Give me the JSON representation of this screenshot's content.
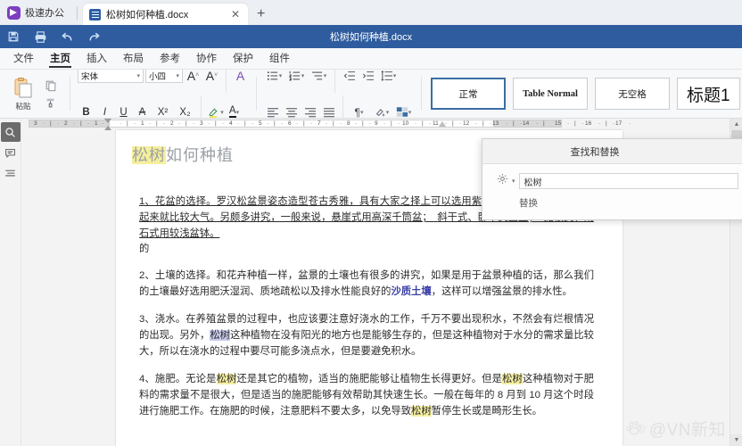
{
  "tabstrip": {
    "brand": "极速办公",
    "brand_icon": "rocket-logo-icon",
    "doc_tab": {
      "title": "松树如何种植.docx",
      "icon": "document-icon",
      "close": "✕"
    },
    "new_tab": "+"
  },
  "quickbar": {
    "title": "松树如何种植.docx",
    "buttons": [
      {
        "name": "save-button",
        "icon": "save-icon"
      },
      {
        "name": "print-button",
        "icon": "printer-icon"
      },
      {
        "name": "undo-button",
        "icon": "undo-arrow-icon"
      },
      {
        "name": "redo-button",
        "icon": "redo-arrow-icon"
      }
    ]
  },
  "menubar": {
    "items": [
      {
        "label": "文件",
        "active": false
      },
      {
        "label": "主页",
        "active": true
      },
      {
        "label": "插入",
        "active": false
      },
      {
        "label": "布局",
        "active": false
      },
      {
        "label": "参考",
        "active": false
      },
      {
        "label": "协作",
        "active": false
      },
      {
        "label": "保护",
        "active": false
      },
      {
        "label": "组件",
        "active": false
      }
    ]
  },
  "ribbon": {
    "paste_label": "粘贴",
    "font_name": "宋体",
    "font_size": "小四",
    "grow_font": "A",
    "shrink_font": "A",
    "clear_format": "A",
    "bold": "B",
    "italic": "I",
    "underline": "U",
    "strike": "A",
    "superscript": "X²",
    "subscript": "X₂",
    "text_highlight": "highlight-pen-icon",
    "font_color": "A",
    "styles": [
      {
        "label": "正常",
        "selected": true
      },
      {
        "label": "Table Normal",
        "selected": false
      },
      {
        "label": "无空格",
        "selected": false
      },
      {
        "label": "标题1",
        "selected": false
      }
    ]
  },
  "leftbar": {
    "items": [
      {
        "name": "search-icon",
        "active": true
      },
      {
        "name": "comment-icon",
        "active": false
      },
      {
        "name": "outline-icon",
        "active": false
      }
    ]
  },
  "ruler": {
    "left_labels": [
      "3",
      "2",
      "1"
    ],
    "right_labels": [
      "1",
      "2",
      "3",
      "4",
      "5",
      "6",
      "7",
      "8",
      "9",
      "10",
      "11",
      "12",
      "13",
      "14",
      "15",
      "16",
      "17"
    ]
  },
  "document": {
    "title_highlight": "松树",
    "title_rest": "如何种植",
    "paragraphs": [
      {
        "id": "p1",
        "underline": true,
        "text": "1、花盆的选择。罗汉松盆景姿态造型苍古秀雅，具有大家之择上可以选用紫砂陶盆或釉陶盆，这样看起来就比较大气。另颇多讲究，一般来说，悬崖式用高深千筒盆；　斜干式、卧干式圆盆；　提根式、附石式用较浅盆钵。"
      },
      {
        "id": "p1b",
        "underline": false,
        "text": "的"
      },
      {
        "id": "p2",
        "underline": false,
        "pre": "2、土壤的选择。和花卉种植一样，盆景的土壤也有很多的讲究，如果是用于盆景种植的话，那么我们的土壤最好选用肥沃湿润、质地疏松以及排水性能良好的",
        "emphasis": "沙质土壤",
        "post": "，这样可以增强盆景的排水性。"
      },
      {
        "id": "p3",
        "underline": false,
        "pre": "3、浇水。在养殖盆景的过程中，也应该要注意好浇水的工作，千万不要出现积水，不然会有烂根情况的出现。另外，",
        "selected": "松树",
        "post": "这种植物在没有阳光的地方也是能够生存的，但是这种植物对于水分的需求量比较大，所以在浇水的过程中要尽可能多浇点水，但是要避免积水。"
      },
      {
        "id": "p4",
        "underline": false,
        "segments": [
          {
            "t": "4、施肥。无论是",
            "m": ""
          },
          {
            "t": "松树",
            "m": "y"
          },
          {
            "t": "还是其它的植物，适当的施肥能够让植物生长得更好。但是",
            "m": ""
          },
          {
            "t": "松树",
            "m": "y"
          },
          {
            "t": "这种植物对于肥料的需求量不是很大，但是适当的施肥能够有效帮助其快速生长。一般在每年的 8 月到 10 月这个时段进行施肥工作。在施肥的时候，注意肥料不要太多，以免导致",
            "m": ""
          },
          {
            "t": "松树",
            "m": "y"
          },
          {
            "t": "暂停生长或是畸形生长。",
            "m": ""
          }
        ]
      }
    ]
  },
  "find_replace": {
    "title": "查找和替换",
    "settings_icon": "gear-icon",
    "dropdown_icon": "chevron-down-icon",
    "search_value": "松树",
    "replace_label": "替换"
  },
  "watermark": {
    "logo": "paw-at-logo-icon",
    "text": "@VN新知"
  },
  "colors": {
    "titlebar": "#2e5c9e",
    "tab_active": "#ffffff",
    "highlight_yellow": "#f7f0a2",
    "selection_blue": "#c9cced",
    "emphasis_blue": "#3b3fa6",
    "ribbon_bg": "#f7f8fa",
    "accent_border": "#3a6ea5"
  }
}
